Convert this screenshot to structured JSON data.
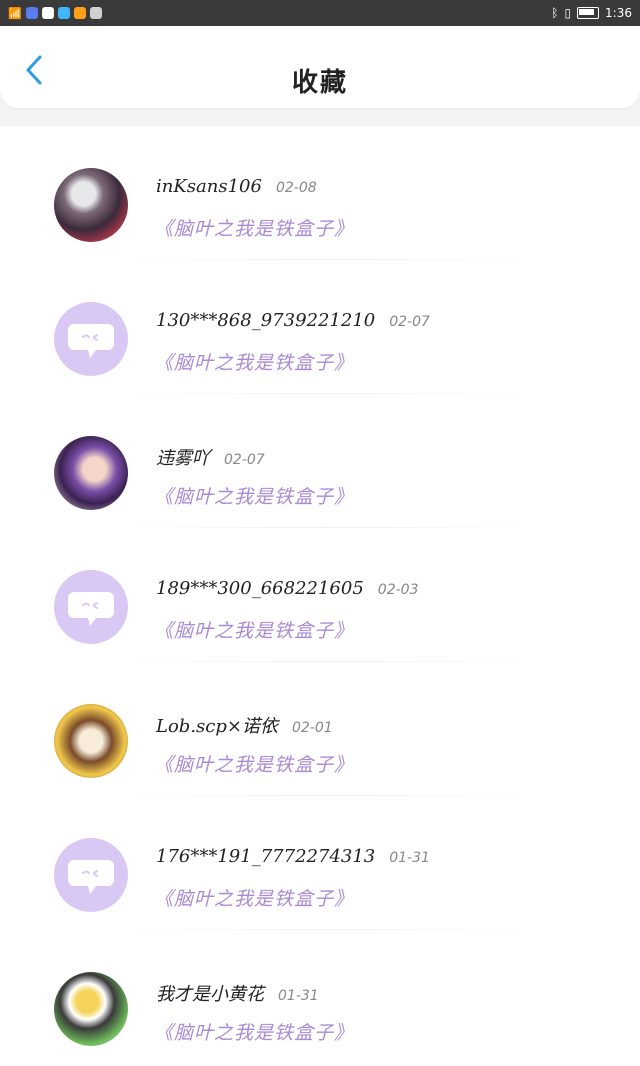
{
  "status_bar": {
    "time": "1:36"
  },
  "header": {
    "title": "收藏"
  },
  "items": [
    {
      "username": "inKsans106",
      "date": "02-08",
      "book": "《脑叶之我是铁盒子》",
      "avatar": "image-1"
    },
    {
      "username": "130***868_9739221210",
      "date": "02-07",
      "book": "《脑叶之我是铁盒子》",
      "avatar": "default"
    },
    {
      "username": "违雾吖",
      "date": "02-07",
      "book": "《脑叶之我是铁盒子》",
      "avatar": "image-2"
    },
    {
      "username": "189***300_668221605",
      "date": "02-03",
      "book": "《脑叶之我是铁盒子》",
      "avatar": "default"
    },
    {
      "username": "Lob.scp×诺依",
      "date": "02-01",
      "book": "《脑叶之我是铁盒子》",
      "avatar": "image-3"
    },
    {
      "username": "176***191_7772274313",
      "date": "01-31",
      "book": "《脑叶之我是铁盒子》",
      "avatar": "default"
    },
    {
      "username": "我才是小黄花",
      "date": "01-31",
      "book": "《脑叶之我是铁盒子》",
      "avatar": "image-4"
    }
  ],
  "colors": {
    "accent_purple": "#a98ad8",
    "back_blue": "#2a9be6",
    "avatar_default": "#d9c8f3"
  },
  "icons": {
    "back": "chevron-left-icon",
    "default_avatar": "chat-bubble-face-icon"
  }
}
